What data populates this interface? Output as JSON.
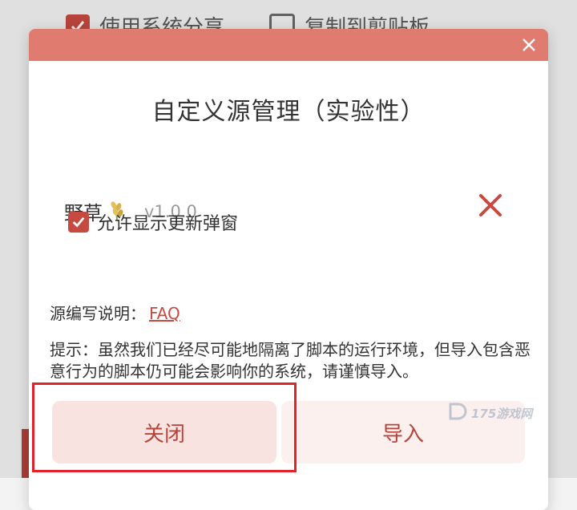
{
  "background": {
    "option_system_share": "使用系统分享",
    "option_copy_clipboard": "复制到剪贴板"
  },
  "dialog": {
    "title": "自定义源管理（实验性）",
    "source": {
      "name": "野草",
      "version": "v1.0.0",
      "allow_update_popup_label": "允许显示更新弹窗",
      "allow_update_popup_checked": true
    },
    "guide_label": "源编写说明：",
    "guide_link": "FAQ",
    "notice": "提示：虽然我们已经尽可能地隔离了脚本的运行环境，但导入包含恶意行为的脚本仍可能会影响你的系统，请谨慎导入。",
    "buttons": {
      "close": "关闭",
      "import": "导入"
    }
  },
  "watermark": {
    "text": "175游戏网"
  },
  "colors": {
    "accent": "#c74a40",
    "header": "#e07b70",
    "highlight": "#e0242c"
  }
}
